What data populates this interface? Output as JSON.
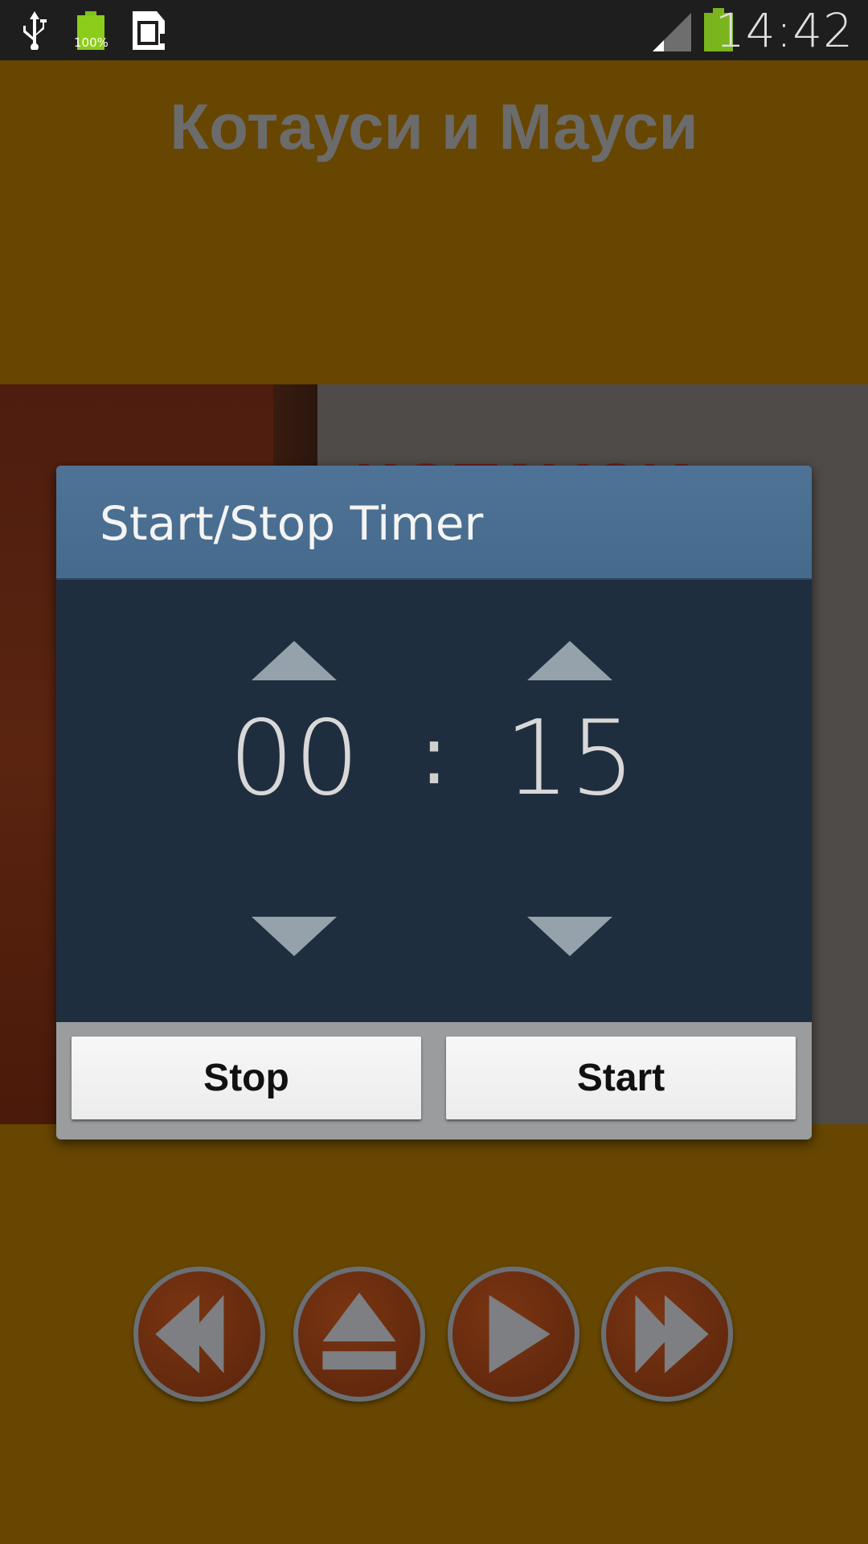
{
  "status_bar": {
    "time": "14:42",
    "battery_label": "100%",
    "icons": [
      "usb-icon",
      "battery-charged-icon",
      "sim-card-icon",
      "signal-icon",
      "battery-icon"
    ],
    "battery_color": "#7ab51d"
  },
  "app": {
    "title": "Котауси и Мауси",
    "background_color": "#664600",
    "cover_text": "КОТАУСИ"
  },
  "dialog": {
    "title": "Start/Stop Timer",
    "minutes": "00",
    "separator": ":",
    "seconds": "15",
    "stop_label": "Stop",
    "start_label": "Start",
    "header_color": "#4a6d8f",
    "body_color": "#1f2e3f"
  },
  "media_controls": [
    "rewind-icon",
    "eject-icon",
    "play-icon",
    "fast-forward-icon"
  ]
}
